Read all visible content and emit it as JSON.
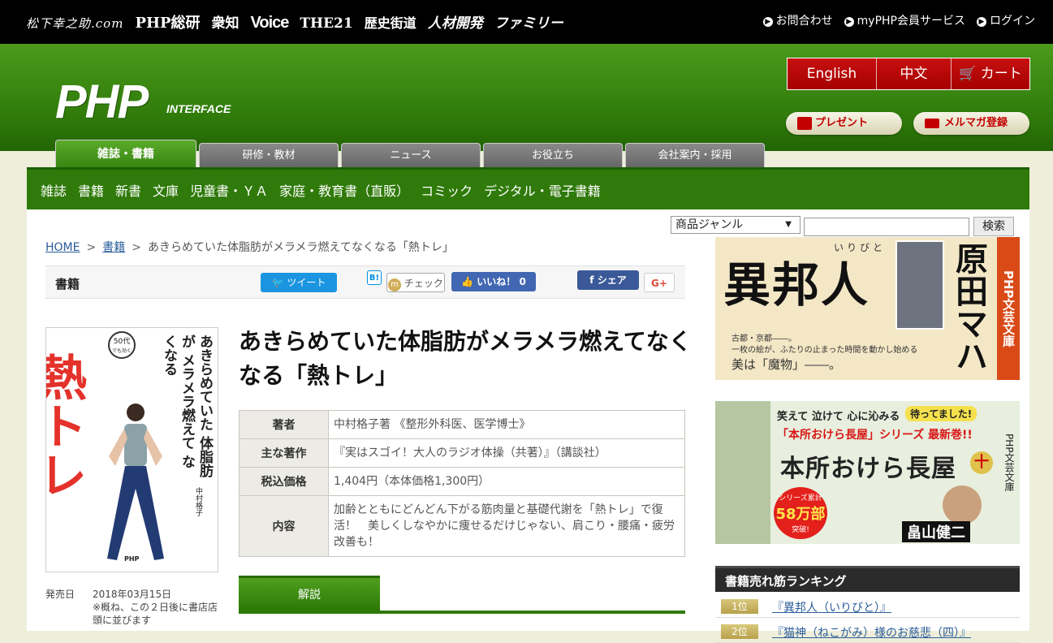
{
  "top": {
    "brands": [
      "松下幸之助.com",
      "PHP総研",
      "衆知",
      "Voice",
      "THE21",
      "歴史街道",
      "人材開発",
      "ファミリー"
    ],
    "links": [
      "お問合わせ",
      "myPHP会員サービス",
      "ログイン"
    ]
  },
  "header": {
    "logo": "PHP",
    "logo_sub": "INTERFACE",
    "lang": [
      "English",
      "中文"
    ],
    "cart": "カート",
    "present": "プレゼント",
    "mailmag": "メルマガ登録"
  },
  "tabs": [
    "雑誌・書籍",
    "研修・教材",
    "ニュース",
    "お役立ち",
    "会社案内・採用"
  ],
  "subnav": [
    "雑誌",
    "書籍",
    "新書",
    "文庫",
    "児童書・ＹＡ",
    "家庭・教育書（直販）",
    "コミック",
    "デジタル・電子書籍"
  ],
  "search": {
    "select": "商品ジャンル",
    "button": "検索"
  },
  "breadcrumb": {
    "home": "HOME",
    "books": "書籍",
    "current": "あきらめていた体脂肪がメラメラ燃えてなくなる「熱トレ」"
  },
  "sharebar": {
    "label": "書籍",
    "tweet": "ツイート",
    "hatena": "B!",
    "check": "チェック",
    "like": "いいね！",
    "like_count": "0",
    "share": "シェア",
    "gplus": "G+"
  },
  "cover": {
    "big": "熱トレ",
    "vertical": "あきらめていた 体脂肪が メラメラ燃えて なくなる",
    "badge_top": "50代",
    "badge_sub": "でも効く",
    "author": "中村格子",
    "publisher": "PHP"
  },
  "book": {
    "title": "あきらめていた体脂肪がメラメラ燃えてなくなる「熱トレ」",
    "rows": [
      {
        "k": "著者",
        "v": "中村格子著 《整形外科医、医学博士》"
      },
      {
        "k": "主な著作",
        "v": "『実はスゴイ！大人のラジオ体操（共著）』（講談社）"
      },
      {
        "k": "税込価格",
        "v": "1,404円（本体価格1,300円）"
      },
      {
        "k": "内容",
        "v": "加齢とともにどんどん下がる筋肉量と基礎代謝を「熱トレ」で復活！　美しくしなやかに痩せるだけじゃない、肩こり・腰痛・疲労改善も！"
      }
    ],
    "release_label": "発売日",
    "release_date": "2018年03月15日",
    "release_note": "※概ね、この２日後に書店店頭に並びます",
    "kaisetsu": "解説"
  },
  "ad1": {
    "title": "異邦人",
    "ruby": "いりびと",
    "author": "原田マハ",
    "label": "PHP文芸文庫",
    "copy1": "古都・京都――。",
    "copy2": "一枚の絵が、ふたりの止まった時間を動かし始める",
    "copy3": "美は「魔物」――。"
  },
  "ad2": {
    "top": "笑えて 泣けて 心に沁みる",
    "wait": "待ってました!",
    "series": "「本所おけら長屋」シリーズ",
    "newest": "最新巻!!",
    "title": "本所おけら長屋",
    "num": "十",
    "sales1": "シリーズ累計",
    "sales2": "58万部",
    "sales3": "突破!",
    "author": "畠山健二",
    "label": "PHP文芸文庫"
  },
  "ranking": {
    "heading": "書籍売れ筋ランキング",
    "items": [
      {
        "no": "1位",
        "title": "『異邦人（いりびと）』"
      },
      {
        "no": "2位",
        "title": "『猫神（ねこがみ）様のお慈悲（四）』"
      }
    ]
  },
  "colors": {
    "green": "#2f7a0a",
    "red": "#b50000",
    "gold": "#c8b35a"
  }
}
